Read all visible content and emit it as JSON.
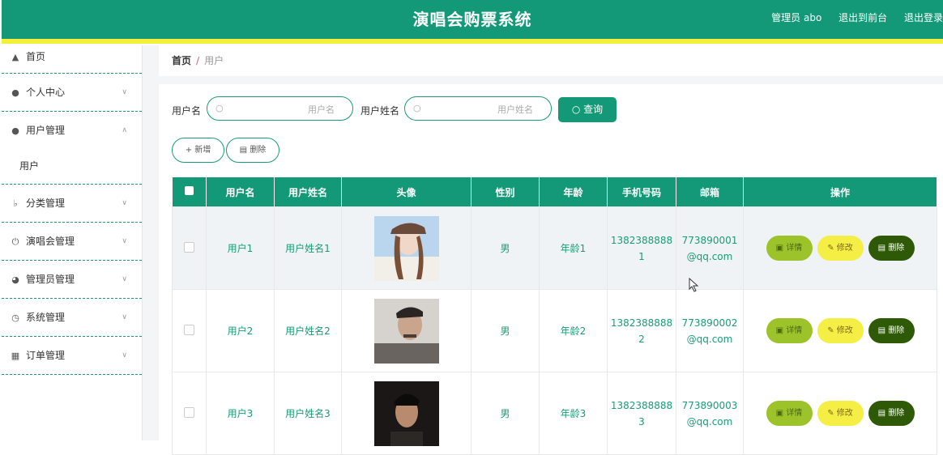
{
  "header": {
    "title": "演唱会购票系统",
    "admin": "管理员 abo",
    "to_front": "退出到前台",
    "logout": "退出登录"
  },
  "sidebar": {
    "items": [
      {
        "label": "首页",
        "icon": "home-icon"
      },
      {
        "label": "个人中心",
        "icon": "user-icon"
      },
      {
        "label": "用户管理",
        "icon": "bulb-icon"
      },
      {
        "label": "用户",
        "icon": ""
      },
      {
        "label": "分类管理",
        "icon": "bell-off-icon"
      },
      {
        "label": "演唱会管理",
        "icon": "power-icon"
      },
      {
        "label": "管理员管理",
        "icon": "gauge-icon"
      },
      {
        "label": "系统管理",
        "icon": "clock-icon"
      },
      {
        "label": "订单管理",
        "icon": "ticket-icon"
      }
    ]
  },
  "breadcrumb": {
    "home": "首页",
    "sep": "/",
    "current": "用户"
  },
  "search": {
    "username_label": "用户名",
    "username_placeholder": "用户名",
    "realname_label": "用户姓名",
    "realname_placeholder": "用户姓名",
    "query_button": "查询"
  },
  "actions": {
    "add": "新增",
    "delete": "删除"
  },
  "table": {
    "headers": [
      "用户名",
      "用户姓名",
      "头像",
      "性别",
      "年龄",
      "手机号码",
      "邮箱",
      "操作"
    ],
    "rows": [
      {
        "username": "用户1",
        "realname": "用户姓名1",
        "gender": "男",
        "age": "年龄1",
        "phone_a": "1382388888",
        "phone_b": "1",
        "email_a": "773890001",
        "email_b": "@qq.com"
      },
      {
        "username": "用户2",
        "realname": "用户姓名2",
        "gender": "男",
        "age": "年龄2",
        "phone_a": "1382388888",
        "phone_b": "2",
        "email_a": "773890002",
        "email_b": "@qq.com"
      },
      {
        "username": "用户3",
        "realname": "用户姓名3",
        "gender": "男",
        "age": "年龄3",
        "phone_a": "1382388888",
        "phone_b": "3",
        "email_a": "773890003",
        "email_b": "@qq.com"
      }
    ],
    "row_buttons": {
      "detail": "详情",
      "edit": "修改",
      "delete": "删除"
    }
  },
  "colors": {
    "primary": "#139978",
    "stripe": "#f6ef3a",
    "detail": "#9cc32a",
    "edit": "#f5ee45",
    "delete": "#2e5a08"
  }
}
